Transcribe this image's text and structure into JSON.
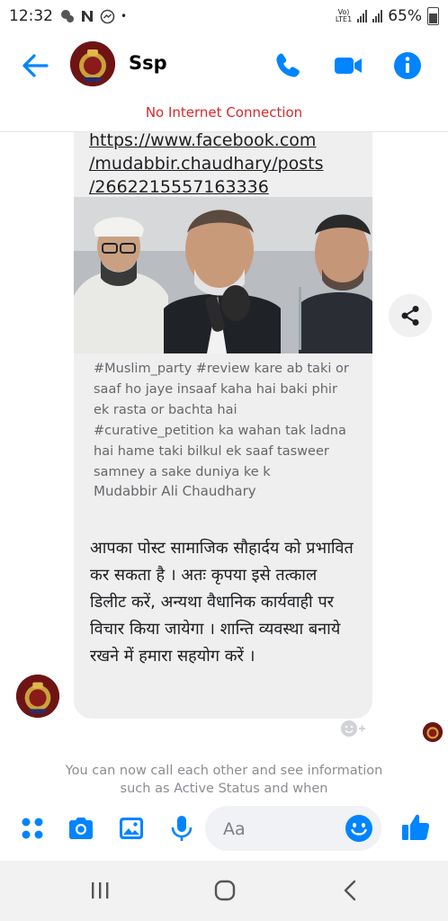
{
  "status_bar": {
    "time": "12:32",
    "volte": "Vo)\nLTE1",
    "battery": "65%"
  },
  "header": {
    "contact_name": "Ssp"
  },
  "banner": {
    "text": "No Internet Connection"
  },
  "messages": {
    "link_lines": [
      "https://www.facebook.com",
      "/mudabbir.chaudhary/posts",
      "/2662215557163336"
    ],
    "preview_description": "#Muslim_party #review kare ab taki or saaf ho jaye insaaf kaha hai baki phir ek rasta or bachta hai #curative_petition ka wahan tak ladna hai hame taki bilkul ek saaf tasweer samney a sake duniya ke k",
    "preview_author": "Mudabbir Ali Chaudhary",
    "hindi_message": "आपका पोस्ट सामाजिक सौहार्दय को प्रभावित कर सकता है । अतः कृपया इसे तत्काल डिलीट करें, अन्यथा वैधानिक कार्यवाही पर विचार किया जायेगा । शान्ति व्यवस्था बनाये रखने में हमारा सहयोग करें ।",
    "system_message": "You can now call each other and see information such as Active Status and when"
  },
  "composer": {
    "placeholder": "Aa"
  },
  "colors": {
    "accent": "#0084ff",
    "banner_red": "#d8282c",
    "bubble": "#efefef"
  },
  "icons": {
    "header": [
      "back-arrow-icon",
      "phone-icon",
      "video-camera-icon",
      "info-icon"
    ],
    "composer": [
      "apps-icon",
      "camera-icon",
      "gallery-icon",
      "microphone-icon",
      "emoji-icon",
      "thumbs-up-icon"
    ],
    "nav": [
      "recent-apps-icon",
      "home-icon",
      "back-icon"
    ]
  }
}
